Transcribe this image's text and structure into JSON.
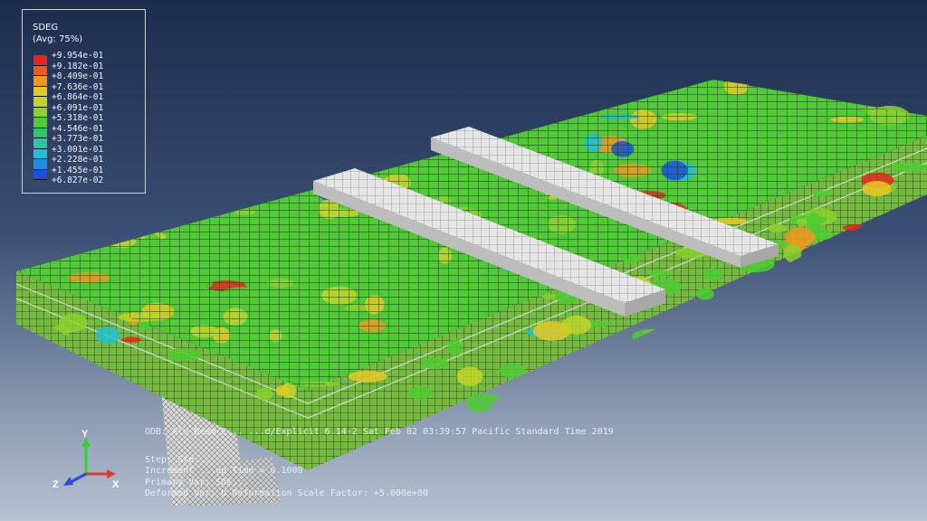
{
  "legend": {
    "title": "SDEG",
    "subtitle": "(Avg: 75%)",
    "entries": [
      {
        "label": "+9.954e-01",
        "color": "#e8241c"
      },
      {
        "label": "+9.182e-01",
        "color": "#ef5a1a"
      },
      {
        "label": "+8.409e-01",
        "color": "#f2961e"
      },
      {
        "label": "+7.636e-01",
        "color": "#e6c825"
      },
      {
        "label": "+6.864e-01",
        "color": "#c2d52a"
      },
      {
        "label": "+6.091e-01",
        "color": "#8cd12e"
      },
      {
        "label": "+5.318e-01",
        "color": "#4dcc33"
      },
      {
        "label": "+4.546e-01",
        "color": "#2fc36a"
      },
      {
        "label": "+3.773e-01",
        "color": "#27c7a6"
      },
      {
        "label": "+3.001e-01",
        "color": "#22bfd6"
      },
      {
        "label": "+2.228e-01",
        "color": "#1e8fe0"
      },
      {
        "label": "+1.455e-01",
        "color": "#1a4fe0"
      },
      {
        "label": "+6.827e-02",
        "color": "#1a1ad6"
      }
    ]
  },
  "info": {
    "odb_line": "ODB: Alu-Beam-E...  ...d/Explicit 6.14-2   Sat Feb 02 03:39:57 Pacific Standard Time 2019",
    "step_line": "Step: Ste...",
    "increment_line": "Increment      ...ep Time =    0.1000",
    "primary_line": "Primary Var: SDE...",
    "deformed_line": "Deformed Var: U   Deformation Scale Factor: +5.000e+00"
  },
  "triad": {
    "x": "X",
    "y": "Y",
    "z": "Z"
  },
  "colors": {
    "mesh_green": "#4dcc33",
    "mesh_line": "#1a3a10",
    "plate_gray": "#e4e4e4",
    "triad_x": "#e23a2a",
    "triad_y": "#2ed42e",
    "triad_z": "#2a4ae0"
  }
}
